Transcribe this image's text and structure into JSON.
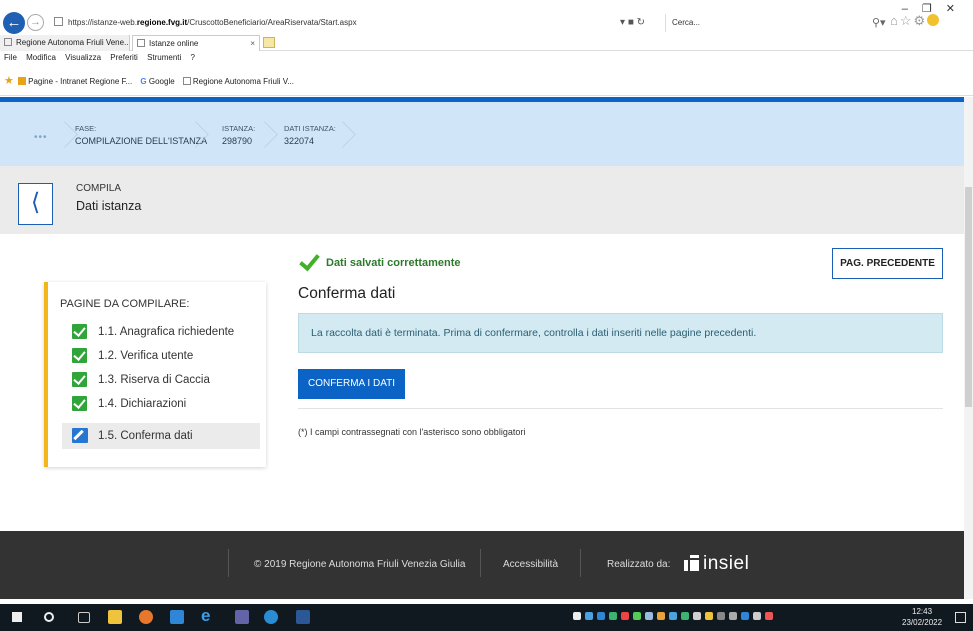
{
  "browser": {
    "url_prefix": "https://istanze-web.",
    "url_domain": "regione.fvg.it",
    "url_suffix": "/CruscottoBeneficiario/AreaRiservata/Start.aspx",
    "search_placeholder": "Cerca...",
    "tabs": [
      {
        "label": "Regione Autonoma Friuli Vene..."
      },
      {
        "label": "Istanze online"
      }
    ],
    "menu": [
      "File",
      "Modifica",
      "Visualizza",
      "Preferiti",
      "Strumenti",
      "?"
    ],
    "favorites": [
      "Pagine - Intranet Regione F...",
      "Google",
      "Regione Autonoma Friuli V..."
    ]
  },
  "phase": {
    "fase_label": "FASE:",
    "fase_value": "COMPILAZIONE DELL'ISTANZA",
    "istanza_label": "ISTANZA:",
    "istanza_value": "298790",
    "dati_label": "DATI ISTANZA:",
    "dati_value": "322074"
  },
  "compila": {
    "label": "COMPILA",
    "title": "Dati istanza"
  },
  "sidebar": {
    "title": "PAGINE DA COMPILARE:",
    "items": [
      {
        "label": "1.1. Anagrafica richiedente",
        "state": "done"
      },
      {
        "label": "1.2. Verifica utente",
        "state": "done"
      },
      {
        "label": "1.3. Riserva di Caccia",
        "state": "done"
      },
      {
        "label": "1.4. Dichiarazioni",
        "state": "done"
      },
      {
        "label": "1.5. Conferma dati",
        "state": "active"
      }
    ]
  },
  "main": {
    "saved_msg": "Dati salvati correttamente",
    "prev_button": "PAG. PRECEDENTE",
    "title": "Conferma dati",
    "info": "La raccolta dati è terminata. Prima di confermare, controlla i dati inseriti nelle pagine precedenti.",
    "confirm_button": "CONFERMA I DATI",
    "required_note": "(*) I campi contrassegnati con l'asterisco sono obbligatori"
  },
  "footer": {
    "copyright": "© 2019 Regione Autonoma Friuli Venezia Giulia",
    "accessibility": "Accessibilità",
    "realizzato": "Realizzato da:",
    "brand": "insiel"
  },
  "taskbar": {
    "time": "12:43",
    "date": "23/02/2022"
  },
  "colors": {
    "accent": "#0b63c5",
    "phase_bg": "#d1e5f9",
    "sidebar_accent": "#f2b51c",
    "success": "#2fa53a",
    "footer_bg": "#333333"
  }
}
